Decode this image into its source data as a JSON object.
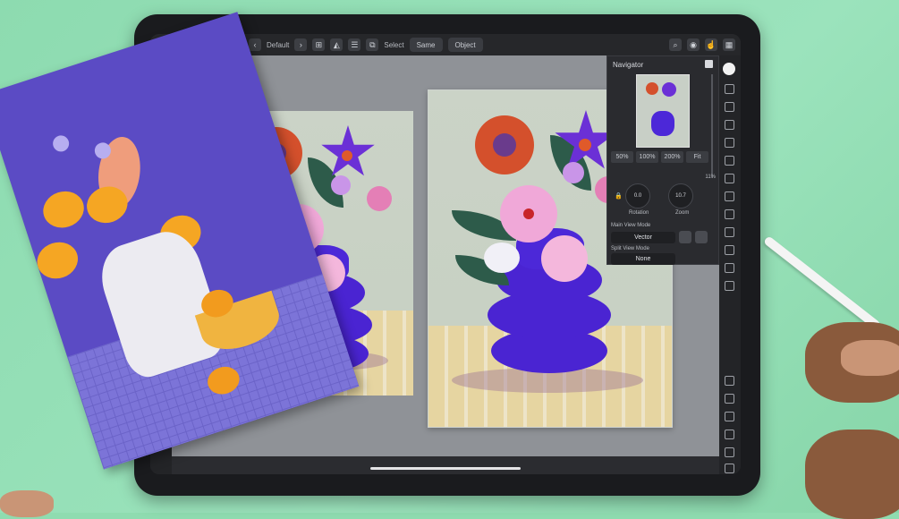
{
  "toolbar": {
    "preset_label": "Default",
    "select_label": "Select",
    "same_label": "Same",
    "object_label": "Object"
  },
  "navigator": {
    "title": "Navigator",
    "zoom_buttons": [
      "50%",
      "100%",
      "200%",
      "Fit"
    ],
    "rotation_value": "0.0",
    "rotation_unit": "°",
    "rotation_label": "Rotation",
    "zoom_value": "10.7",
    "zoom_unit": "%",
    "zoom_label": "Zoom",
    "main_view_mode_label": "Main View Mode",
    "main_view_mode_value": "Vector",
    "split_view_mode_label": "Split View Mode",
    "split_view_mode_value": "None",
    "slider_value_label": "11%"
  },
  "icons": [
    "menu-icon",
    "more-icon",
    "move-tool-icon",
    "brush-icon",
    "chevron-left-icon",
    "search-icon",
    "eye-icon",
    "hand-tool-icon",
    "layers-icon",
    "pen-icon",
    "fill-icon",
    "text-icon",
    "grid-icon",
    "chevron-up-icon",
    "chevron-down-icon",
    "settings-icon"
  ],
  "colors": {
    "accent": "#4c28d8",
    "background": "#8fdcb0",
    "panel": "#2a2b2f"
  }
}
